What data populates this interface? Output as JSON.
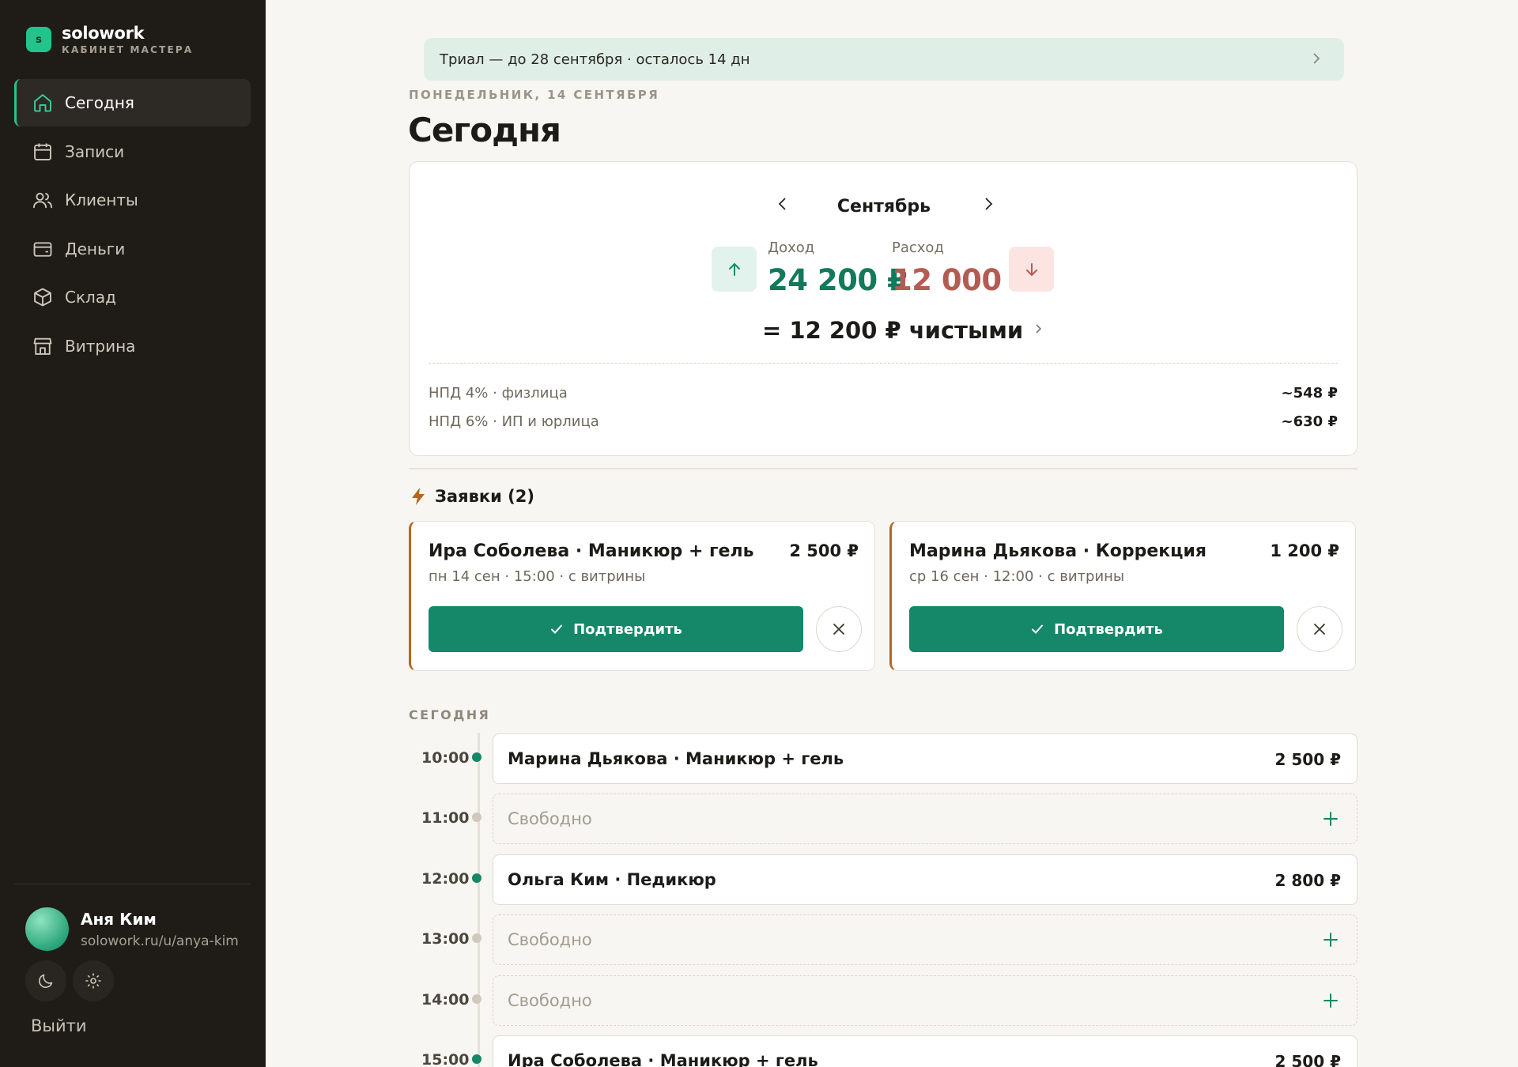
{
  "app": {
    "name": "solowork",
    "subtitle": "КАБИНЕТ МАСТЕРА",
    "logo_letter": "s",
    "accent": "#23c38c"
  },
  "nav": [
    {
      "label": "Сегодня",
      "icon": "home-icon",
      "active": true
    },
    {
      "label": "Записи",
      "icon": "calendar-icon",
      "active": false
    },
    {
      "label": "Клиенты",
      "icon": "users-icon",
      "active": false
    },
    {
      "label": "Деньги",
      "icon": "wallet-icon",
      "active": false
    },
    {
      "label": "Склад",
      "icon": "box-icon",
      "active": false
    },
    {
      "label": "Витрина",
      "icon": "store-icon",
      "active": false
    }
  ],
  "user": {
    "name": "Аня Ким",
    "link": "solowork.ru/u/anya-kim"
  },
  "logout": "Выйти",
  "trial": {
    "text": "Триал — до 28 сентября · осталось 14 дн"
  },
  "header": {
    "date": "ПОНЕДЕЛЬНИК, 14 СЕНТЯБРЯ",
    "title": "Сегодня"
  },
  "summary": {
    "month": "Сентябрь",
    "income_label": "Доход",
    "income_value": "24 200 ₽",
    "expense_label": "Расход",
    "expense_value": "12 000 ₽",
    "net": "= 12 200 ₽ чистыми",
    "taxes": [
      {
        "label": "НПД 4% · физлица",
        "value": "~548 ₽"
      },
      {
        "label": "НПД 6% · ИП и юрлица",
        "value": "~630 ₽"
      }
    ]
  },
  "requests": {
    "title": "Заявки (2)",
    "items": [
      {
        "title": "Ира Соболева · Маникюр + гель",
        "price": "2 500 ₽",
        "meta": "пн 14 сен · 15:00 · с витрины",
        "confirm": "Подтвердить"
      },
      {
        "title": "Марина Дьякова · Коррекция",
        "price": "1 200 ₽",
        "meta": "ср 16 сен · 12:00 · с витрины",
        "confirm": "Подтвердить"
      }
    ]
  },
  "schedule": {
    "label": "СЕГОДНЯ",
    "slots": [
      {
        "time": "10:00",
        "status": "busy",
        "title": "Марина Дьякова · Маникюр + гель",
        "price": "2 500 ₽"
      },
      {
        "time": "11:00",
        "status": "free",
        "title": "Свободно",
        "price": ""
      },
      {
        "time": "12:00",
        "status": "busy",
        "title": "Ольга Ким · Педикюр",
        "price": "2 800 ₽"
      },
      {
        "time": "13:00",
        "status": "free",
        "title": "Свободно",
        "price": ""
      },
      {
        "time": "14:00",
        "status": "free",
        "title": "Свободно",
        "price": ""
      },
      {
        "time": "15:00",
        "status": "busy",
        "title": "Ира Соболева · Маникюр + гель",
        "price": "2 500 ₽"
      }
    ]
  }
}
